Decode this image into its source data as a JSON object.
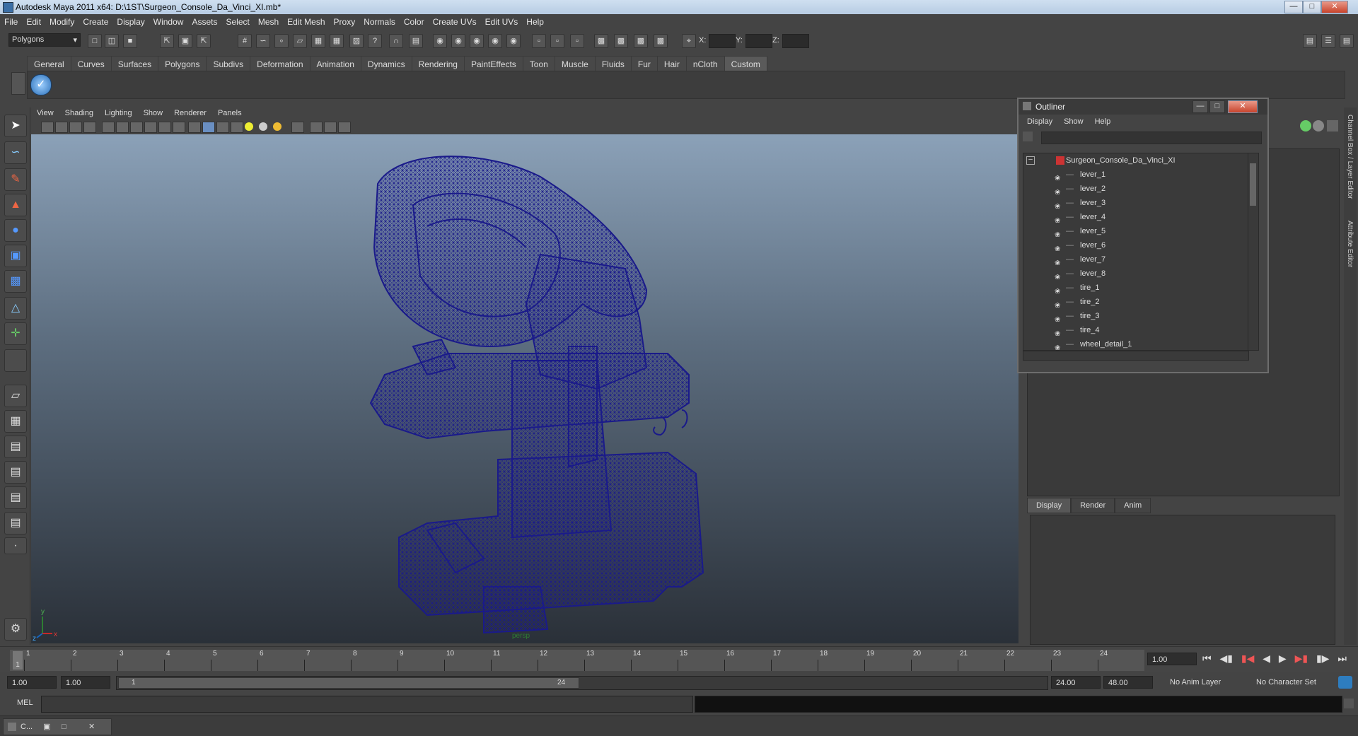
{
  "window": {
    "title": "Autodesk Maya 2011 x64: D:\\1ST\\Surgeon_Console_Da_Vinci_XI.mb*"
  },
  "menubar": [
    "File",
    "Edit",
    "Modify",
    "Create",
    "Display",
    "Window",
    "Assets",
    "Select",
    "Mesh",
    "Edit Mesh",
    "Proxy",
    "Normals",
    "Color",
    "Create UVs",
    "Edit UVs",
    "Help"
  ],
  "statusline": {
    "mode": "Polygons",
    "x_label": "X:",
    "y_label": "Y:",
    "z_label": "Z:"
  },
  "shelf": {
    "tabs": [
      "General",
      "Curves",
      "Surfaces",
      "Polygons",
      "Subdivs",
      "Deformation",
      "Animation",
      "Dynamics",
      "Rendering",
      "PaintEffects",
      "Toon",
      "Muscle",
      "Fluids",
      "Fur",
      "Hair",
      "nCloth",
      "Custom"
    ],
    "active": "Custom"
  },
  "viewport": {
    "menu": [
      "View",
      "Shading",
      "Lighting",
      "Show",
      "Renderer",
      "Panels"
    ],
    "camera_label": "persp",
    "axis_y": "y",
    "axis_x": "x",
    "axis_z": "z",
    "wire_color": "#1a1a8a"
  },
  "outliner": {
    "title": "Outliner",
    "menu": [
      "Display",
      "Show",
      "Help"
    ],
    "root": "Surgeon_Console_Da_Vinci_XI",
    "items": [
      "lever_1",
      "lever_2",
      "lever_3",
      "lever_4",
      "lever_5",
      "lever_6",
      "lever_7",
      "lever_8",
      "tire_1",
      "tire_2",
      "tire_3",
      "tire_4",
      "wheel_detail_1"
    ]
  },
  "side_tabs": {
    "channel_box": "Channel Box / Layer Editor",
    "attribute_editor": "Attribute Editor"
  },
  "layer_editor": {
    "tabs": [
      "Display",
      "Render",
      "Anim"
    ],
    "active": "Display"
  },
  "timeline": {
    "ticks": [
      "1",
      "2",
      "3",
      "4",
      "5",
      "6",
      "7",
      "8",
      "9",
      "10",
      "11",
      "12",
      "13",
      "14",
      "15",
      "16",
      "17",
      "18",
      "19",
      "20",
      "21",
      "22",
      "23",
      "24"
    ],
    "current_frame": "1",
    "current_time": "1.00"
  },
  "range": {
    "start": "1.00",
    "playback_start": "1.00",
    "slider_start": "1",
    "slider_end": "24",
    "playback_end": "24.00",
    "end": "48.00",
    "anim_layer": "No Anim Layer",
    "character_set": "No Character Set"
  },
  "commandline": {
    "label": "MEL"
  },
  "taskbar": {
    "item": "C..."
  }
}
